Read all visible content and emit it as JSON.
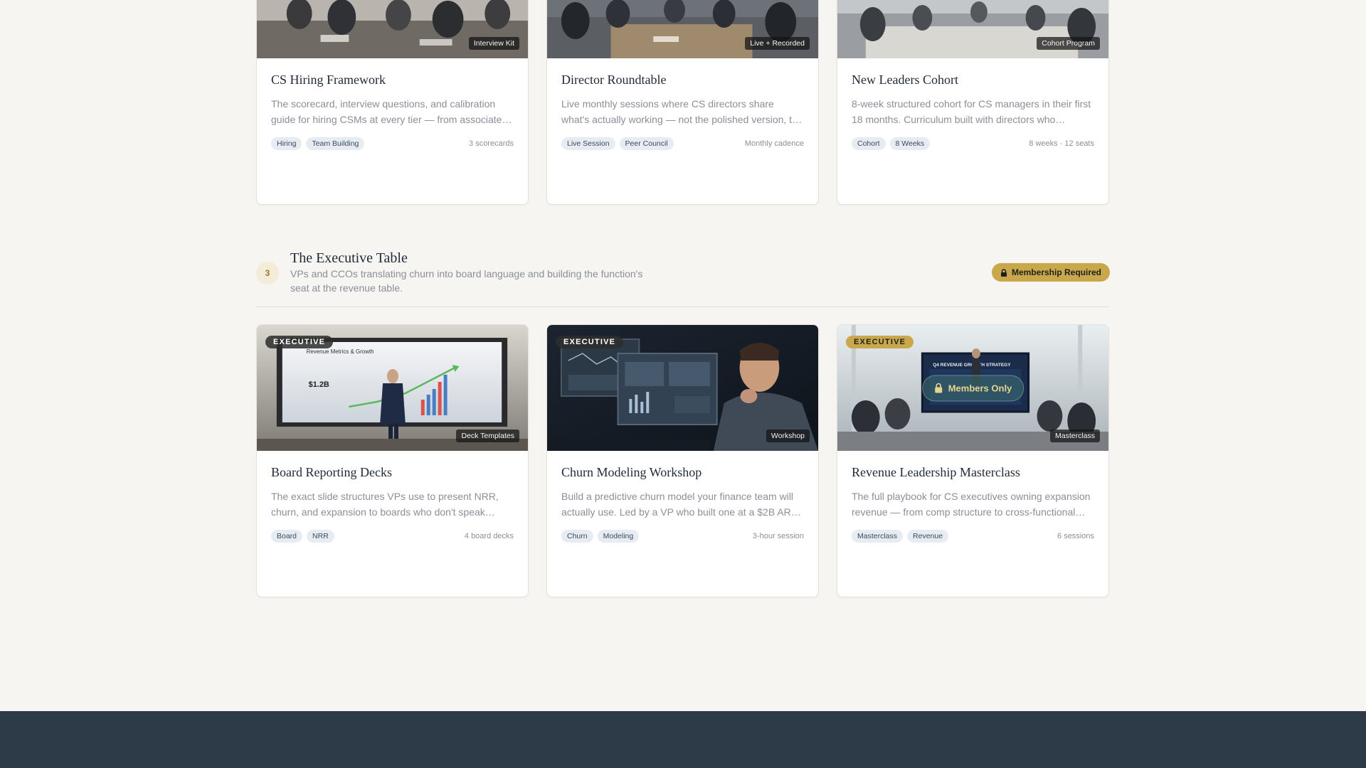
{
  "row1": [
    {
      "title": "CS Hiring Framework",
      "desc": "The scorecard, interview questions, and calibration guide for hiring CSMs at every tier — from associate…",
      "type": "Interview Kit",
      "tags": [
        "Hiring",
        "Team Building"
      ],
      "meta": "3 scorecards"
    },
    {
      "title": "Director Roundtable",
      "desc": "Live monthly sessions where CS directors share what's actually working — not the polished version, the real…",
      "type": "Live + Recorded",
      "tags": [
        "Live Session",
        "Peer Council"
      ],
      "meta": "Monthly cadence"
    },
    {
      "title": "New Leaders Cohort",
      "desc": "8-week structured cohort for CS managers in their first 18 months. Curriculum built with directors who…",
      "type": "Cohort Program",
      "tags": [
        "Cohort",
        "8 Weeks"
      ],
      "meta": "8 weeks · 12 seats"
    }
  ],
  "section": {
    "step": "3",
    "title": "The Executive Table",
    "subtitle": "VPs and CCOs translating churn into board language and building the function's seat at the revenue table.",
    "membership_label": "Membership Required"
  },
  "row2": [
    {
      "tier": "EXECUTIVE",
      "title": "Board Reporting Decks",
      "desc": "The exact slide structures VPs use to present NRR, churn, and expansion to boards who don't speak CS.…",
      "type": "Deck Templates",
      "tags": [
        "Board",
        "NRR"
      ],
      "meta": "4 board decks",
      "image_text": {
        "slide_title": "Revenue Metrics & Growth",
        "big_number": "$1.2B"
      }
    },
    {
      "tier": "EXECUTIVE",
      "title": "Churn Modeling Workshop",
      "desc": "Build a predictive churn model your finance team will actually use. Led by a VP who built one at a $2B AR…",
      "type": "Workshop",
      "tags": [
        "Churn",
        "Modeling"
      ],
      "meta": "3-hour session"
    },
    {
      "tier": "EXECUTIVE",
      "title": "Revenue Leadership Masterclass",
      "desc": "The full playbook for CS executives owning expansion revenue — from comp structure to cross-functional…",
      "type": "Masterclass",
      "tags": [
        "Masterclass",
        "Revenue"
      ],
      "meta": "6 sessions",
      "overlay_label": "Members Only",
      "image_text": {
        "screen_title": "Q4 REVENUE GROWTH STRATEGY"
      }
    }
  ],
  "colors": {
    "gold": "#c9a84c",
    "footer": "#2d3a48",
    "tag_bg": "#e7ecf3",
    "page_bg": "#f6f5f2"
  }
}
